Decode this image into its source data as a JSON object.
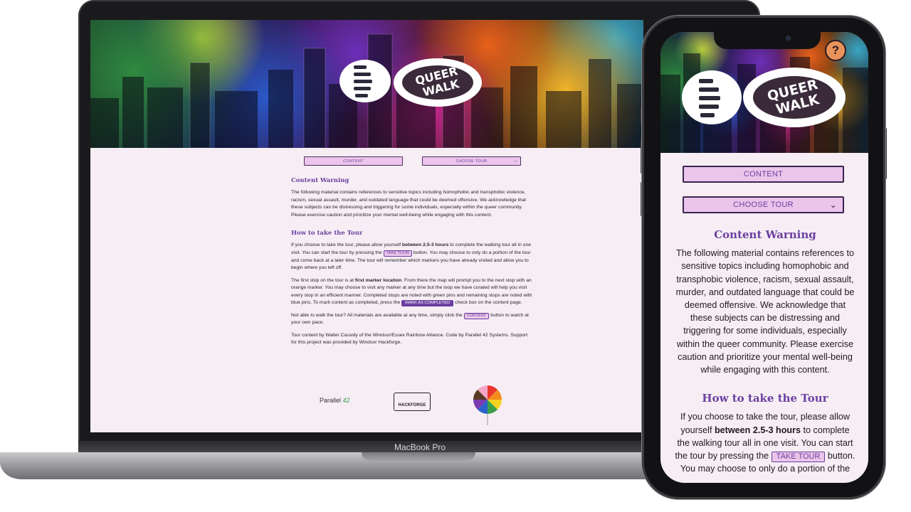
{
  "laptop": {
    "model_label": "MacBook Pro",
    "logo_alt": "QUEER WALK",
    "buttons": {
      "content": "CONTENT",
      "choose_tour": "CHOOSE TOUR"
    },
    "warning": {
      "heading": "Content Warning",
      "body": "The following material contains references to sensitive topics including homophobic and transphobic violence, racism, sexual assault, murder, and outdated language that could be deemed offensive. We acknowledge that these subjects can be distressing and triggering for some individuals, especially within the queer community. Please exercise caution and prioritize your mental well-being while engaging with this content."
    },
    "howto": {
      "heading": "How to take the Tour",
      "p1_a": "If you choose to take the tour, please allow yourself ",
      "p1_bold": "between 2.5-3 hours",
      "p1_b": " to complete the walking tour all in one visit. You can start the tour by pressing the ",
      "p1_chip": "TAKE TOUR",
      "p1_c": " button. You may choose to only do a portion of the tour and come back at a later time. The tour will remember which markers you have already visited and allow you to begin where you left off.",
      "p2_a": "The first stop on the tour is at ",
      "p2_bold": "first marker location",
      "p2_b": ". From there the map will prompt you to the next stop with an orange marker. You may choose to visit any marker at any time but the loop we have curated will help you visit every stop in an efficient manner. Completed stops are noted with green pins and remaining stops are noted with blue pins. To mark content as completed, press the ",
      "p2_chip": "MARK AS COMPLETED",
      "p2_c": " check box on the content page.",
      "p3_a": "Not able to walk the tour? All materials are available at any time, simply click the ",
      "p3_chip": "CONTENT",
      "p3_b": " button to watch at your own pace.",
      "p4": "Tour content by Walter Cassidy of the Windsor/Essex Rainbow Alliance. Code by Parallel 42 Systems. Support for this project was provided by Windsor Hackforge."
    },
    "logos": {
      "parallel_a": "Parallel ",
      "parallel_b": "42",
      "hackforge": "HACKFORGE"
    }
  },
  "phone": {
    "help_label": "?",
    "buttons": {
      "content": "CONTENT",
      "choose_tour": "CHOOSE TOUR"
    },
    "warning": {
      "heading": "Content Warning",
      "body": "The following material contains references to sensitive topics including homophobic and transphobic violence, racism, sexual assault, murder, and outdated language that could be deemed offensive. We acknowledge that these subjects can be distressing and triggering for some individuals, especially within the queer community. Please exercise caution and prioritize your mental well-being while engaging with this content."
    },
    "howto": {
      "heading": "How to take the Tour",
      "p1_a": "If you choose to take the tour, please allow yourself ",
      "p1_bold": "between 2.5-3 hours",
      "p1_b": " to complete the walking tour all in one visit. You can start the tour by pressing the ",
      "p1_chip": "TAKE TOUR",
      "p1_c": " button. You may choose to only do a portion of the"
    }
  },
  "colors": {
    "accent": "#6b3fa0",
    "button_bg": "#ebc5ea",
    "page_bg": "#f6eef4",
    "help_button": "#e8935a"
  },
  "icons": [
    "chevron-down-icon",
    "boot-print-logo-icon",
    "help-icon",
    "camera-icon"
  ]
}
